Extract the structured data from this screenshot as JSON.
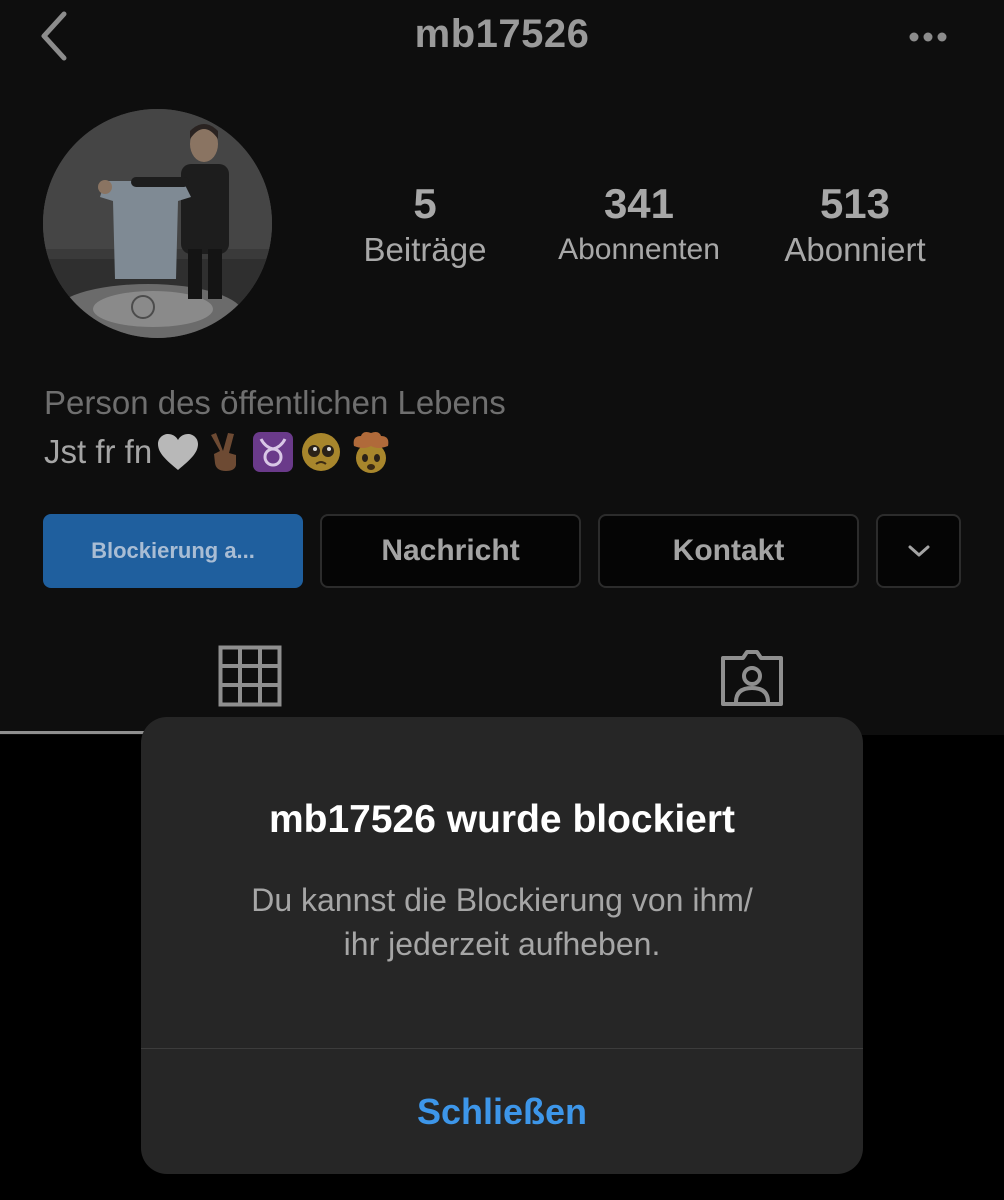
{
  "header": {
    "title": "mb17526",
    "back_icon": "chevron-left-icon",
    "more_icon": "ellipsis-icon"
  },
  "profile": {
    "avatar_icon": "profile-photo",
    "stats": {
      "posts": {
        "value": "5",
        "label": "Beiträge"
      },
      "followers": {
        "value": "341",
        "label": "Abonnenten"
      },
      "following": {
        "value": "513",
        "label": "Abonniert"
      }
    },
    "bio": {
      "category": "Person des öffentlichen Lebens",
      "text": "Jst fr fn",
      "emojis": [
        "white-heart-emoji",
        "victory-hand-emoji",
        "taurus-emoji",
        "pleading-face-emoji",
        "exploding-head-emoji"
      ]
    }
  },
  "actions": {
    "unblock_label": "Blockierung a...",
    "message_label": "Nachricht",
    "contact_label": "Kontakt",
    "more_icon": "chevron-down-icon"
  },
  "tabs": {
    "grid_icon": "grid-icon",
    "tagged_icon": "tagged-person-icon"
  },
  "dialog": {
    "title": "mb17526 wurde blockiert",
    "body_line1": "Du kannst die Blockierung von ihm/",
    "body_line2": "ihr jederzeit aufheben.",
    "close_label": "Schließen"
  },
  "colors": {
    "accent_blue": "#3d96e9",
    "unblock_button": "#1f5f9e",
    "dialog_bg": "#262626",
    "background": "#000000"
  }
}
